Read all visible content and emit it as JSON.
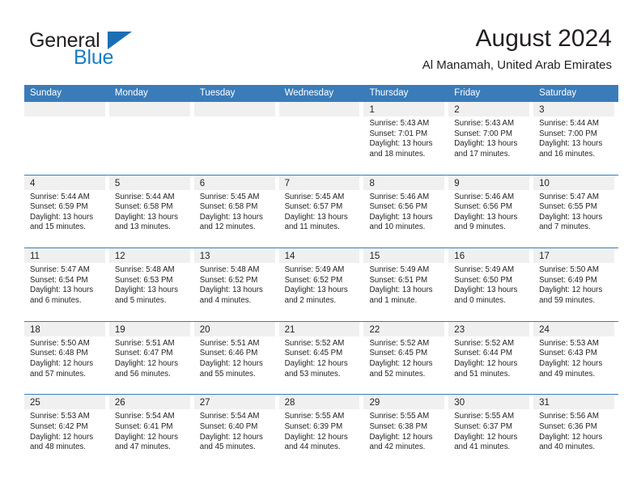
{
  "brand": {
    "name_part1": "General",
    "name_part2": "Blue"
  },
  "header": {
    "title": "August 2024",
    "location": "Al Manamah, United Arab Emirates"
  },
  "colors": {
    "header_blue": "#3a7cb9",
    "logo_blue": "#1a7dc4",
    "daynum_band": "#f0f0f0",
    "text": "#231f20"
  },
  "weekdays": [
    "Sunday",
    "Monday",
    "Tuesday",
    "Wednesday",
    "Thursday",
    "Friday",
    "Saturday"
  ],
  "weeks": [
    [
      {
        "day": "",
        "sunrise": "",
        "sunset": "",
        "daylight": "",
        "daylight2": ""
      },
      {
        "day": "",
        "sunrise": "",
        "sunset": "",
        "daylight": "",
        "daylight2": ""
      },
      {
        "day": "",
        "sunrise": "",
        "sunset": "",
        "daylight": "",
        "daylight2": ""
      },
      {
        "day": "",
        "sunrise": "",
        "sunset": "",
        "daylight": "",
        "daylight2": ""
      },
      {
        "day": "1",
        "sunrise": "Sunrise: 5:43 AM",
        "sunset": "Sunset: 7:01 PM",
        "daylight": "Daylight: 13 hours",
        "daylight2": "and 18 minutes."
      },
      {
        "day": "2",
        "sunrise": "Sunrise: 5:43 AM",
        "sunset": "Sunset: 7:00 PM",
        "daylight": "Daylight: 13 hours",
        "daylight2": "and 17 minutes."
      },
      {
        "day": "3",
        "sunrise": "Sunrise: 5:44 AM",
        "sunset": "Sunset: 7:00 PM",
        "daylight": "Daylight: 13 hours",
        "daylight2": "and 16 minutes."
      }
    ],
    [
      {
        "day": "4",
        "sunrise": "Sunrise: 5:44 AM",
        "sunset": "Sunset: 6:59 PM",
        "daylight": "Daylight: 13 hours",
        "daylight2": "and 15 minutes."
      },
      {
        "day": "5",
        "sunrise": "Sunrise: 5:44 AM",
        "sunset": "Sunset: 6:58 PM",
        "daylight": "Daylight: 13 hours",
        "daylight2": "and 13 minutes."
      },
      {
        "day": "6",
        "sunrise": "Sunrise: 5:45 AM",
        "sunset": "Sunset: 6:58 PM",
        "daylight": "Daylight: 13 hours",
        "daylight2": "and 12 minutes."
      },
      {
        "day": "7",
        "sunrise": "Sunrise: 5:45 AM",
        "sunset": "Sunset: 6:57 PM",
        "daylight": "Daylight: 13 hours",
        "daylight2": "and 11 minutes."
      },
      {
        "day": "8",
        "sunrise": "Sunrise: 5:46 AM",
        "sunset": "Sunset: 6:56 PM",
        "daylight": "Daylight: 13 hours",
        "daylight2": "and 10 minutes."
      },
      {
        "day": "9",
        "sunrise": "Sunrise: 5:46 AM",
        "sunset": "Sunset: 6:56 PM",
        "daylight": "Daylight: 13 hours",
        "daylight2": "and 9 minutes."
      },
      {
        "day": "10",
        "sunrise": "Sunrise: 5:47 AM",
        "sunset": "Sunset: 6:55 PM",
        "daylight": "Daylight: 13 hours",
        "daylight2": "and 7 minutes."
      }
    ],
    [
      {
        "day": "11",
        "sunrise": "Sunrise: 5:47 AM",
        "sunset": "Sunset: 6:54 PM",
        "daylight": "Daylight: 13 hours",
        "daylight2": "and 6 minutes."
      },
      {
        "day": "12",
        "sunrise": "Sunrise: 5:48 AM",
        "sunset": "Sunset: 6:53 PM",
        "daylight": "Daylight: 13 hours",
        "daylight2": "and 5 minutes."
      },
      {
        "day": "13",
        "sunrise": "Sunrise: 5:48 AM",
        "sunset": "Sunset: 6:52 PM",
        "daylight": "Daylight: 13 hours",
        "daylight2": "and 4 minutes."
      },
      {
        "day": "14",
        "sunrise": "Sunrise: 5:49 AM",
        "sunset": "Sunset: 6:52 PM",
        "daylight": "Daylight: 13 hours",
        "daylight2": "and 2 minutes."
      },
      {
        "day": "15",
        "sunrise": "Sunrise: 5:49 AM",
        "sunset": "Sunset: 6:51 PM",
        "daylight": "Daylight: 13 hours",
        "daylight2": "and 1 minute."
      },
      {
        "day": "16",
        "sunrise": "Sunrise: 5:49 AM",
        "sunset": "Sunset: 6:50 PM",
        "daylight": "Daylight: 13 hours",
        "daylight2": "and 0 minutes."
      },
      {
        "day": "17",
        "sunrise": "Sunrise: 5:50 AM",
        "sunset": "Sunset: 6:49 PM",
        "daylight": "Daylight: 12 hours",
        "daylight2": "and 59 minutes."
      }
    ],
    [
      {
        "day": "18",
        "sunrise": "Sunrise: 5:50 AM",
        "sunset": "Sunset: 6:48 PM",
        "daylight": "Daylight: 12 hours",
        "daylight2": "and 57 minutes."
      },
      {
        "day": "19",
        "sunrise": "Sunrise: 5:51 AM",
        "sunset": "Sunset: 6:47 PM",
        "daylight": "Daylight: 12 hours",
        "daylight2": "and 56 minutes."
      },
      {
        "day": "20",
        "sunrise": "Sunrise: 5:51 AM",
        "sunset": "Sunset: 6:46 PM",
        "daylight": "Daylight: 12 hours",
        "daylight2": "and 55 minutes."
      },
      {
        "day": "21",
        "sunrise": "Sunrise: 5:52 AM",
        "sunset": "Sunset: 6:45 PM",
        "daylight": "Daylight: 12 hours",
        "daylight2": "and 53 minutes."
      },
      {
        "day": "22",
        "sunrise": "Sunrise: 5:52 AM",
        "sunset": "Sunset: 6:45 PM",
        "daylight": "Daylight: 12 hours",
        "daylight2": "and 52 minutes."
      },
      {
        "day": "23",
        "sunrise": "Sunrise: 5:52 AM",
        "sunset": "Sunset: 6:44 PM",
        "daylight": "Daylight: 12 hours",
        "daylight2": "and 51 minutes."
      },
      {
        "day": "24",
        "sunrise": "Sunrise: 5:53 AM",
        "sunset": "Sunset: 6:43 PM",
        "daylight": "Daylight: 12 hours",
        "daylight2": "and 49 minutes."
      }
    ],
    [
      {
        "day": "25",
        "sunrise": "Sunrise: 5:53 AM",
        "sunset": "Sunset: 6:42 PM",
        "daylight": "Daylight: 12 hours",
        "daylight2": "and 48 minutes."
      },
      {
        "day": "26",
        "sunrise": "Sunrise: 5:54 AM",
        "sunset": "Sunset: 6:41 PM",
        "daylight": "Daylight: 12 hours",
        "daylight2": "and 47 minutes."
      },
      {
        "day": "27",
        "sunrise": "Sunrise: 5:54 AM",
        "sunset": "Sunset: 6:40 PM",
        "daylight": "Daylight: 12 hours",
        "daylight2": "and 45 minutes."
      },
      {
        "day": "28",
        "sunrise": "Sunrise: 5:55 AM",
        "sunset": "Sunset: 6:39 PM",
        "daylight": "Daylight: 12 hours",
        "daylight2": "and 44 minutes."
      },
      {
        "day": "29",
        "sunrise": "Sunrise: 5:55 AM",
        "sunset": "Sunset: 6:38 PM",
        "daylight": "Daylight: 12 hours",
        "daylight2": "and 42 minutes."
      },
      {
        "day": "30",
        "sunrise": "Sunrise: 5:55 AM",
        "sunset": "Sunset: 6:37 PM",
        "daylight": "Daylight: 12 hours",
        "daylight2": "and 41 minutes."
      },
      {
        "day": "31",
        "sunrise": "Sunrise: 5:56 AM",
        "sunset": "Sunset: 6:36 PM",
        "daylight": "Daylight: 12 hours",
        "daylight2": "and 40 minutes."
      }
    ]
  ]
}
